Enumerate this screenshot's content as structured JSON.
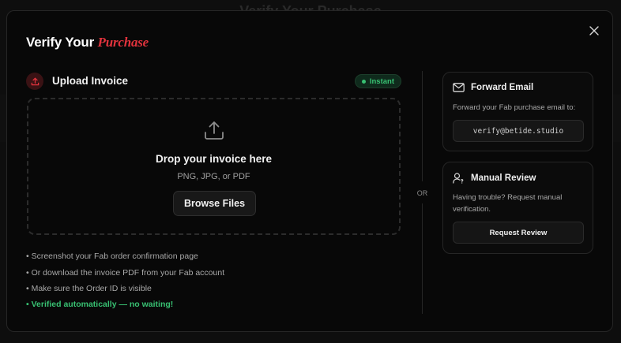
{
  "background": {
    "ghost_title": "Verify Your Purchase"
  },
  "modal": {
    "title_prefix": "Verify Your ",
    "title_accent": "Purchase",
    "accent_color": "#e2333d"
  },
  "upload": {
    "title": "Upload Invoice",
    "badge": "Instant",
    "drop_title": "Drop your invoice here",
    "drop_formats": "PNG, JPG, or PDF",
    "browse_label": "Browse Files",
    "tips": [
      "• Screenshot your Fab order confirmation page",
      "• Or download the invoice PDF from your Fab account",
      "• Make sure the Order ID is visible"
    ],
    "auto_note": "• Verified automatically — no waiting!",
    "success_color": "#38c172"
  },
  "divider_label": "OR",
  "forward_email": {
    "title": "Forward Email",
    "description": "Forward your Fab purchase email to:",
    "address": "verify@betide.studio"
  },
  "manual_review": {
    "title": "Manual Review",
    "description": "Having trouble? Request manual verification.",
    "button_label": "Request Review"
  }
}
